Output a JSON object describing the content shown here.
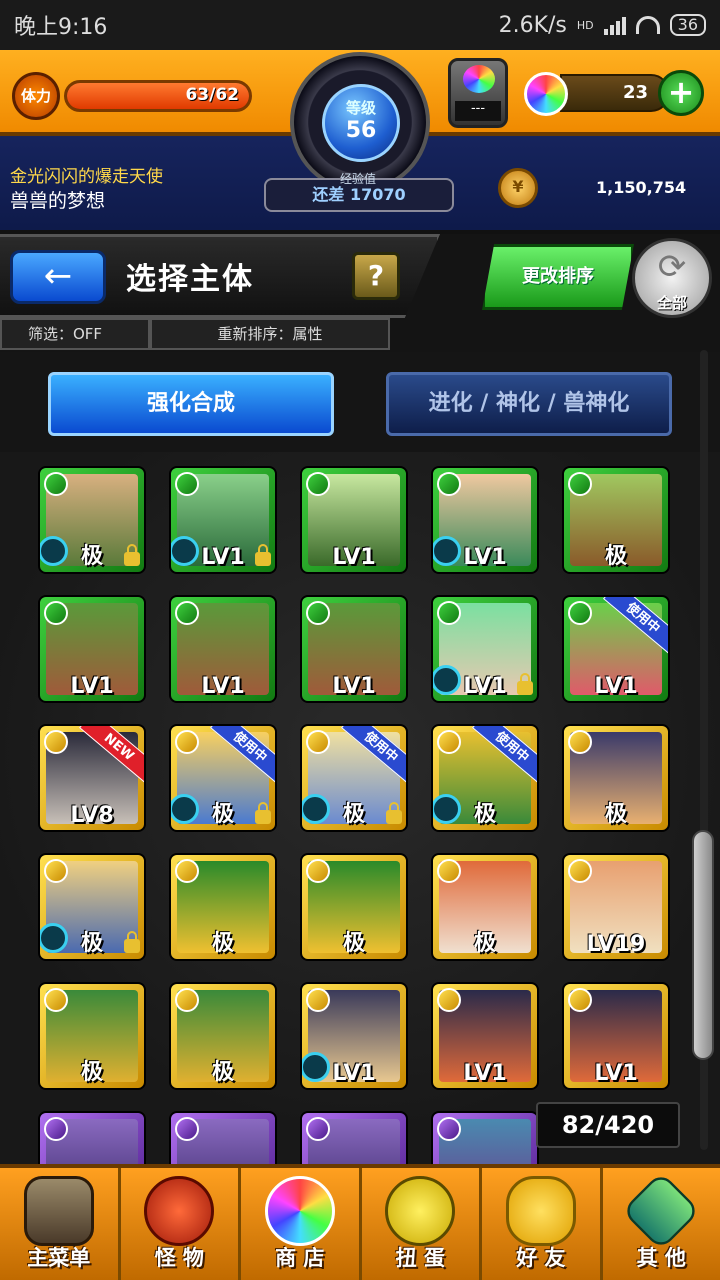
{
  "status_bar": {
    "time": "晚上9:16",
    "net_speed": "2.6K/s",
    "hd": "HD",
    "battery": "36"
  },
  "hud": {
    "stamina_label": "体力",
    "stamina": "63/62",
    "stamina_fill": 1.0,
    "level_label": "等级",
    "level": "56",
    "egg_text": "---",
    "orbs": "23",
    "plus_label": "+",
    "title_line": "金光闪闪的爆走天使",
    "subtitle_line": "兽兽的梦想",
    "exp_label": "经验值",
    "exp_text": "还差 17070",
    "coin_symbol": "¥",
    "coins": "1,150,754"
  },
  "header": {
    "back_icon": "←",
    "title": "选择主体",
    "help": "?",
    "filter": "筛选：OFF",
    "sort": "重新排序：属性",
    "reorder": "更改排序",
    "all_icon": "⟳",
    "all": "全部"
  },
  "tabs": {
    "active": "强化合成",
    "inactive": "进化 / 神化 / 兽神化"
  },
  "grid": {
    "count": "82/420",
    "cells": [
      {
        "frame": "green",
        "art": "a1",
        "label": "极",
        "lock": true,
        "orb": true,
        "badge": ""
      },
      {
        "frame": "green",
        "art": "a2",
        "label": "LV1",
        "lock": true,
        "orb": true,
        "badge": ""
      },
      {
        "frame": "green",
        "art": "a3",
        "label": "LV1",
        "lock": false,
        "orb": false,
        "badge": ""
      },
      {
        "frame": "green",
        "art": "a4",
        "label": "LV1",
        "lock": false,
        "orb": true,
        "badge": ""
      },
      {
        "frame": "green",
        "art": "a5",
        "label": "极",
        "lock": false,
        "orb": false,
        "badge": ""
      },
      {
        "frame": "green",
        "art": "a6",
        "label": "LV1",
        "lock": false,
        "orb": false,
        "badge": ""
      },
      {
        "frame": "green",
        "art": "a6",
        "label": "LV1",
        "lock": false,
        "orb": false,
        "badge": ""
      },
      {
        "frame": "green",
        "art": "a6",
        "label": "LV1",
        "lock": false,
        "orb": false,
        "badge": ""
      },
      {
        "frame": "green",
        "art": "a7",
        "label": "LV1",
        "lock": true,
        "orb": true,
        "badge": ""
      },
      {
        "frame": "green",
        "art": "a8",
        "label": "LV1",
        "lock": false,
        "orb": false,
        "badge": "使用中"
      },
      {
        "frame": "gold",
        "art": "a9",
        "label": "LV8",
        "lock": false,
        "orb": false,
        "badge": "NEW"
      },
      {
        "frame": "gold",
        "art": "a10",
        "label": "极",
        "lock": true,
        "orb": true,
        "badge": "使用中"
      },
      {
        "frame": "gold",
        "art": "a11",
        "label": "极",
        "lock": true,
        "orb": true,
        "badge": "使用中"
      },
      {
        "frame": "gold",
        "art": "a12",
        "label": "极",
        "lock": false,
        "orb": true,
        "badge": "使用中"
      },
      {
        "frame": "gold",
        "art": "a13",
        "label": "极",
        "lock": false,
        "orb": false,
        "badge": ""
      },
      {
        "frame": "gold",
        "art": "a14",
        "label": "极",
        "lock": true,
        "orb": true,
        "badge": ""
      },
      {
        "frame": "gold",
        "art": "a15",
        "label": "极",
        "lock": false,
        "orb": false,
        "badge": ""
      },
      {
        "frame": "gold",
        "art": "a15",
        "label": "极",
        "lock": false,
        "orb": false,
        "badge": ""
      },
      {
        "frame": "gold",
        "art": "a16",
        "label": "极",
        "lock": false,
        "orb": false,
        "badge": ""
      },
      {
        "frame": "gold",
        "art": "a17",
        "label": "LV19",
        "lock": false,
        "orb": false,
        "badge": ""
      },
      {
        "frame": "gold",
        "art": "a18",
        "label": "极",
        "lock": false,
        "orb": false,
        "badge": ""
      },
      {
        "frame": "gold",
        "art": "a18",
        "label": "极",
        "lock": false,
        "orb": false,
        "badge": ""
      },
      {
        "frame": "gold",
        "art": "a19",
        "label": "LV1",
        "lock": false,
        "orb": true,
        "badge": ""
      },
      {
        "frame": "gold",
        "art": "a20",
        "label": "LV1",
        "lock": false,
        "orb": false,
        "badge": ""
      },
      {
        "frame": "gold",
        "art": "a20",
        "label": "LV1",
        "lock": false,
        "orb": false,
        "badge": ""
      },
      {
        "frame": "purple",
        "art": "a21",
        "label": "",
        "lock": false,
        "orb": false,
        "badge": ""
      },
      {
        "frame": "purple",
        "art": "a21",
        "label": "",
        "lock": false,
        "orb": false,
        "badge": ""
      },
      {
        "frame": "purple",
        "art": "a21",
        "label": "",
        "lock": false,
        "orb": false,
        "badge": ""
      },
      {
        "frame": "purple",
        "art": "a22",
        "label": "",
        "lock": false,
        "orb": false,
        "badge": ""
      }
    ]
  },
  "bottom_nav": [
    {
      "label": "主菜单",
      "icon": "i-menu",
      "name": "main-menu"
    },
    {
      "label": "怪 物",
      "icon": "i-monster",
      "name": "monster"
    },
    {
      "label": "商 店",
      "icon": "i-shop",
      "name": "shop"
    },
    {
      "label": "扭 蛋",
      "icon": "i-gacha",
      "name": "gacha"
    },
    {
      "label": "好 友",
      "icon": "i-friend",
      "name": "friend"
    },
    {
      "label": "其 他",
      "icon": "i-other",
      "name": "other"
    }
  ]
}
